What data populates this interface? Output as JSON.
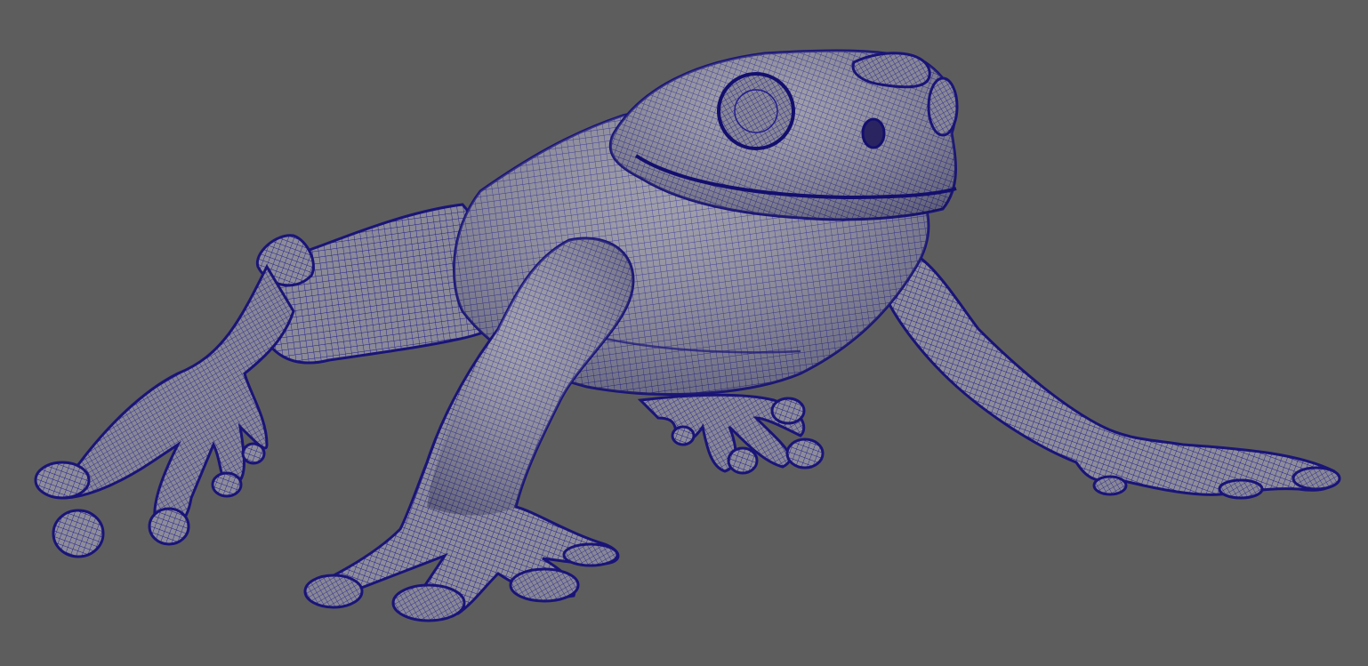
{
  "viewport": {
    "background_color": "#5d5d5d",
    "display_mode": "wireframe-on-shaded"
  },
  "model": {
    "subject": "frog",
    "shading_color": "#8a8a96",
    "wireframe_color": "#1a1496"
  }
}
